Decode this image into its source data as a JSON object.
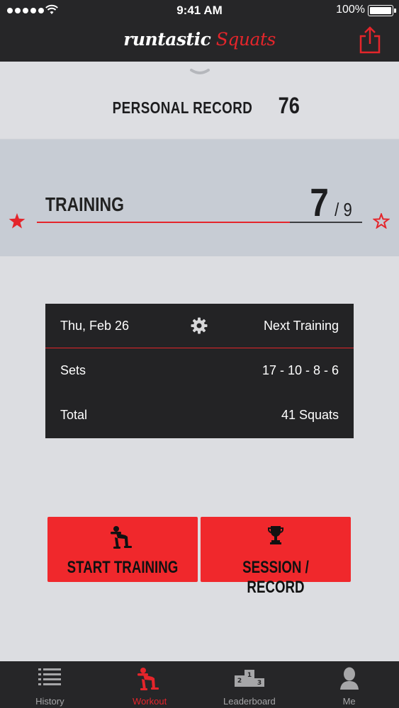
{
  "status_bar": {
    "time": "9:41 AM",
    "battery": "100%"
  },
  "header": {
    "brand": "runtastic",
    "app_name": "Squats",
    "share_icon": "share-icon"
  },
  "personal_record": {
    "label": "PERSONAL RECORD",
    "value": "76"
  },
  "training": {
    "label": "TRAINING",
    "current": "7",
    "total": "/ 9",
    "progress_fraction": 0.778
  },
  "plan": {
    "date": "Thu, Feb 26",
    "next_label": "Next Training",
    "sets_label": "Sets",
    "sets_value": "17 - 10 - 8 - 6",
    "total_label": "Total",
    "total_value": "41 Squats"
  },
  "actions": {
    "start_label": "START TRAINING",
    "session_label": "SESSION / RECORD"
  },
  "tabs": [
    {
      "label": "History",
      "icon": "list-icon"
    },
    {
      "label": "Workout",
      "icon": "squat-icon",
      "active": true
    },
    {
      "label": "Leaderboard",
      "icon": "podium-icon"
    },
    {
      "label": "Me",
      "icon": "person-icon"
    }
  ],
  "colors": {
    "accent": "#e4252b",
    "dark": "#262628",
    "button": "#f0282c"
  }
}
